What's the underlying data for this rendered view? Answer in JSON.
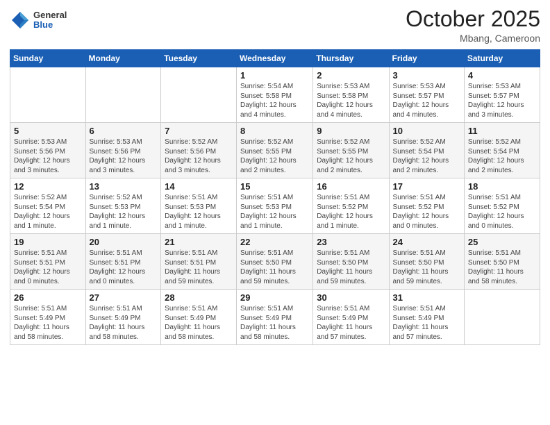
{
  "header": {
    "logo": {
      "general": "General",
      "blue": "Blue"
    },
    "month": "October 2025",
    "location": "Mbang, Cameroon"
  },
  "days_of_week": [
    "Sunday",
    "Monday",
    "Tuesday",
    "Wednesday",
    "Thursday",
    "Friday",
    "Saturday"
  ],
  "weeks": [
    [
      {
        "day": "",
        "info": ""
      },
      {
        "day": "",
        "info": ""
      },
      {
        "day": "",
        "info": ""
      },
      {
        "day": "1",
        "info": "Sunrise: 5:54 AM\nSunset: 5:58 PM\nDaylight: 12 hours\nand 4 minutes."
      },
      {
        "day": "2",
        "info": "Sunrise: 5:53 AM\nSunset: 5:58 PM\nDaylight: 12 hours\nand 4 minutes."
      },
      {
        "day": "3",
        "info": "Sunrise: 5:53 AM\nSunset: 5:57 PM\nDaylight: 12 hours\nand 4 minutes."
      },
      {
        "day": "4",
        "info": "Sunrise: 5:53 AM\nSunset: 5:57 PM\nDaylight: 12 hours\nand 3 minutes."
      }
    ],
    [
      {
        "day": "5",
        "info": "Sunrise: 5:53 AM\nSunset: 5:56 PM\nDaylight: 12 hours\nand 3 minutes."
      },
      {
        "day": "6",
        "info": "Sunrise: 5:53 AM\nSunset: 5:56 PM\nDaylight: 12 hours\nand 3 minutes."
      },
      {
        "day": "7",
        "info": "Sunrise: 5:52 AM\nSunset: 5:56 PM\nDaylight: 12 hours\nand 3 minutes."
      },
      {
        "day": "8",
        "info": "Sunrise: 5:52 AM\nSunset: 5:55 PM\nDaylight: 12 hours\nand 2 minutes."
      },
      {
        "day": "9",
        "info": "Sunrise: 5:52 AM\nSunset: 5:55 PM\nDaylight: 12 hours\nand 2 minutes."
      },
      {
        "day": "10",
        "info": "Sunrise: 5:52 AM\nSunset: 5:54 PM\nDaylight: 12 hours\nand 2 minutes."
      },
      {
        "day": "11",
        "info": "Sunrise: 5:52 AM\nSunset: 5:54 PM\nDaylight: 12 hours\nand 2 minutes."
      }
    ],
    [
      {
        "day": "12",
        "info": "Sunrise: 5:52 AM\nSunset: 5:54 PM\nDaylight: 12 hours\nand 1 minute."
      },
      {
        "day": "13",
        "info": "Sunrise: 5:52 AM\nSunset: 5:53 PM\nDaylight: 12 hours\nand 1 minute."
      },
      {
        "day": "14",
        "info": "Sunrise: 5:51 AM\nSunset: 5:53 PM\nDaylight: 12 hours\nand 1 minute."
      },
      {
        "day": "15",
        "info": "Sunrise: 5:51 AM\nSunset: 5:53 PM\nDaylight: 12 hours\nand 1 minute."
      },
      {
        "day": "16",
        "info": "Sunrise: 5:51 AM\nSunset: 5:52 PM\nDaylight: 12 hours\nand 1 minute."
      },
      {
        "day": "17",
        "info": "Sunrise: 5:51 AM\nSunset: 5:52 PM\nDaylight: 12 hours\nand 0 minutes."
      },
      {
        "day": "18",
        "info": "Sunrise: 5:51 AM\nSunset: 5:52 PM\nDaylight: 12 hours\nand 0 minutes."
      }
    ],
    [
      {
        "day": "19",
        "info": "Sunrise: 5:51 AM\nSunset: 5:51 PM\nDaylight: 12 hours\nand 0 minutes."
      },
      {
        "day": "20",
        "info": "Sunrise: 5:51 AM\nSunset: 5:51 PM\nDaylight: 12 hours\nand 0 minutes."
      },
      {
        "day": "21",
        "info": "Sunrise: 5:51 AM\nSunset: 5:51 PM\nDaylight: 11 hours\nand 59 minutes."
      },
      {
        "day": "22",
        "info": "Sunrise: 5:51 AM\nSunset: 5:50 PM\nDaylight: 11 hours\nand 59 minutes."
      },
      {
        "day": "23",
        "info": "Sunrise: 5:51 AM\nSunset: 5:50 PM\nDaylight: 11 hours\nand 59 minutes."
      },
      {
        "day": "24",
        "info": "Sunrise: 5:51 AM\nSunset: 5:50 PM\nDaylight: 11 hours\nand 59 minutes."
      },
      {
        "day": "25",
        "info": "Sunrise: 5:51 AM\nSunset: 5:50 PM\nDaylight: 11 hours\nand 58 minutes."
      }
    ],
    [
      {
        "day": "26",
        "info": "Sunrise: 5:51 AM\nSunset: 5:49 PM\nDaylight: 11 hours\nand 58 minutes."
      },
      {
        "day": "27",
        "info": "Sunrise: 5:51 AM\nSunset: 5:49 PM\nDaylight: 11 hours\nand 58 minutes."
      },
      {
        "day": "28",
        "info": "Sunrise: 5:51 AM\nSunset: 5:49 PM\nDaylight: 11 hours\nand 58 minutes."
      },
      {
        "day": "29",
        "info": "Sunrise: 5:51 AM\nSunset: 5:49 PM\nDaylight: 11 hours\nand 58 minutes."
      },
      {
        "day": "30",
        "info": "Sunrise: 5:51 AM\nSunset: 5:49 PM\nDaylight: 11 hours\nand 57 minutes."
      },
      {
        "day": "31",
        "info": "Sunrise: 5:51 AM\nSunset: 5:49 PM\nDaylight: 11 hours\nand 57 minutes."
      },
      {
        "day": "",
        "info": ""
      }
    ]
  ]
}
